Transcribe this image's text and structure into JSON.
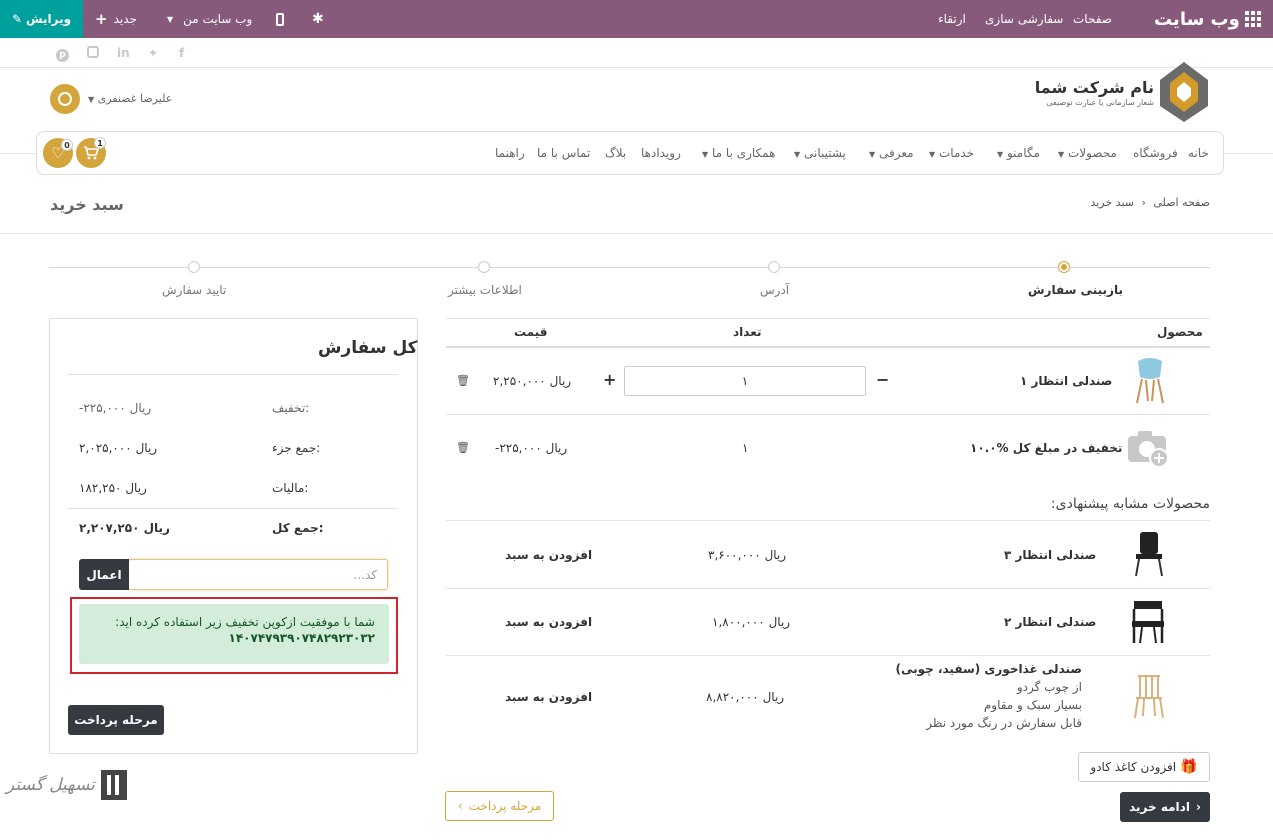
{
  "topbar": {
    "brand": "وب سایت",
    "menu": [
      "صفحات",
      "سفارشی سازی",
      "ارتقاء"
    ],
    "edit_label": "ویرایش",
    "new_label": "جدید",
    "my_site_label": "وب سایت من",
    "colors": {
      "bar": "#875a7b",
      "edit": "#00a09d"
    }
  },
  "company": {
    "name": "نام شرکت شما",
    "tagline": "شعار سازمانی یا عبارت توصیفی"
  },
  "user": {
    "name": "علیرضا غضنفری"
  },
  "nav": {
    "items": [
      {
        "label": "خانه",
        "caret": false
      },
      {
        "label": "فروشگاه",
        "caret": false
      },
      {
        "label": "محصولات",
        "caret": true
      },
      {
        "label": "مگامنو",
        "caret": true
      },
      {
        "label": "خدمات",
        "caret": true
      },
      {
        "label": "معرفی",
        "caret": true
      },
      {
        "label": "پشتیبانی",
        "caret": true
      },
      {
        "label": "همکاری با ما",
        "caret": true
      },
      {
        "label": "رویدادها",
        "caret": false
      },
      {
        "label": "بلاگ",
        "caret": false
      },
      {
        "label": "تماس با ما",
        "caret": false
      },
      {
        "label": "راهنما",
        "caret": false
      }
    ],
    "cart_count": "1",
    "wishlist_count": "0"
  },
  "page": {
    "title": "سبد خرید",
    "breadcrumb_home": "صفحه اصلی",
    "breadcrumb_current": "سبد خرید"
  },
  "steps": [
    "بازبینی سفارش",
    "آدرس",
    "اطلاعات بیشتر",
    "تایید سفارش"
  ],
  "cart": {
    "headers": {
      "product": "محصول",
      "qty": "تعداد",
      "price": "قیمت"
    },
    "rows": [
      {
        "name": "صندلی انتظار ۱",
        "qty": "۱",
        "price": "۲,۲۵۰,۰۰۰ ریال"
      },
      {
        "name": "۱۰.۰% تخفیف در مبلغ کل",
        "qty": "۱",
        "price": "-۲۲۵,۰۰۰ ریال"
      }
    ]
  },
  "suggested": {
    "title": "محصولات مشابه پیشنهادی:",
    "add_label": "افزودن به سبد",
    "items": [
      {
        "name": "صندلی انتظار ۳",
        "price": "۳,۶۰۰,۰۰۰ ریال"
      },
      {
        "name": "صندلی انتظار ۲",
        "price": "۱,۸۰۰,۰۰۰ ریال"
      },
      {
        "name": "صندلی غذاخوری (سفید، چوبی)",
        "desc": [
          "از چوب گردو",
          "بسیار سبک و مقاوم",
          "قابل سفارش در رنگ مورد نظر"
        ],
        "price": "۸,۸۲۰,۰۰۰ ریال"
      }
    ]
  },
  "gift_wrap": "افزودن کاغذ کادو",
  "continue_shopping": "ادامه خرید",
  "checkout_step": "مرحله پرداخت",
  "summary": {
    "title": "کل سفارش",
    "discount_label": "تخفیف:",
    "discount_value": "-۲۲۵,۰۰۰ ریال",
    "subtotal_label": "جمع جزء:",
    "subtotal_value": "۲,۰۲۵,۰۰۰ ریال",
    "tax_label": "مالیات:",
    "tax_value": "۱۸۲,۲۵۰ ریال",
    "total_label": "جمع کل:",
    "total_value": "۲,۲۰۷,۲۵۰ ریال",
    "coupon_placeholder": "کد...",
    "apply_label": "اعمال",
    "success_line1": "شما با موفقیت ازکوپن تخفیف زیر استفاده کرده اید:",
    "success_code": "۱۴۰۷۴۷۹۳۹۰۷۴۸۲۹۲۳۰۳۲",
    "checkout_label": "مرحله پرداخت"
  },
  "watermark": "تسهیل گستر"
}
